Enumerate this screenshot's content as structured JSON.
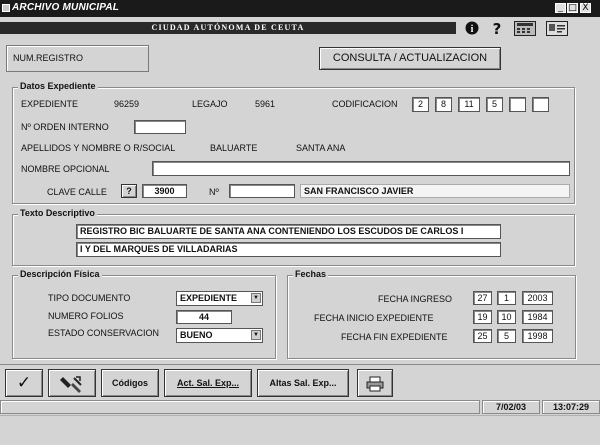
{
  "window": {
    "title": "ARCHIVO MUNICIPAL",
    "minimize": "_",
    "maximize": "□",
    "close": "X"
  },
  "banner": {
    "text": "CIUDAD AUTÓNOMA DE CEUTA",
    "info": "i",
    "help": "?"
  },
  "header": {
    "num_registro": "NUM.REGISTRO",
    "consulta_button": "CONSULTA / ACTUALIZACION"
  },
  "datos": {
    "legend": "Datos Expediente",
    "expediente_label": "EXPEDIENTE",
    "expediente_value": "96259",
    "legajo_label": "LEGAJO",
    "legajo_value": "5961",
    "codificacion_label": "CODIFICACION",
    "codificacion": [
      "2",
      "8",
      "11",
      "5",
      "",
      ""
    ],
    "orden_label": "Nº ORDEN INTERNO",
    "orden_value": "",
    "apellidos_label": "APELLIDOS Y NOMBRE O R/SOCIAL",
    "apellidos_value1": "BALUARTE",
    "apellidos_value2": "SANTA ANA",
    "nombre_opcional_label": "NOMBRE OPCIONAL",
    "nombre_opcional_value": "",
    "clave_calle_label": "CLAVE CALLE",
    "clave_help": "?",
    "clave_value": "3900",
    "numero_label": "Nº",
    "numero_value": "",
    "calle_name": "SAN FRANCISCO JAVIER"
  },
  "texto": {
    "legend": "Texto Descriptivo",
    "line1": "REGISTRO BIC BALUARTE DE SANTA ANA CONTENIENDO LOS ESCUDOS DE CARLOS I",
    "line2": "I Y DEL MARQUES DE VILLADARIAS"
  },
  "fisica": {
    "legend": "Descripción Física",
    "tipo_label": "TIPO DOCUMENTO",
    "tipo_value": "EXPEDIENTE",
    "folios_label": "NUMERO FOLIOS",
    "folios_value": "44",
    "estado_label": "ESTADO CONSERVACION",
    "estado_value": "BUENO"
  },
  "fechas": {
    "legend": "Fechas",
    "ingreso_label": "FECHA INGRESO",
    "ingreso": [
      "27",
      "1",
      "2003"
    ],
    "inicio_label": "FECHA INICIO EXPEDIENTE",
    "inicio": [
      "19",
      "10",
      "1984"
    ],
    "fin_label": "FECHA FIN EXPEDIENTE",
    "fin": [
      "25",
      "5",
      "1998"
    ]
  },
  "toolbar": {
    "accept_glyph": "✓",
    "codigos": "Códigos",
    "act_sal": "Act. Sal. Exp...",
    "altas_sal": "Altas Sal. Exp...",
    "print_glyph": "🖶"
  },
  "statusbar": {
    "date": "7/02/03",
    "time": "13:07:29"
  }
}
